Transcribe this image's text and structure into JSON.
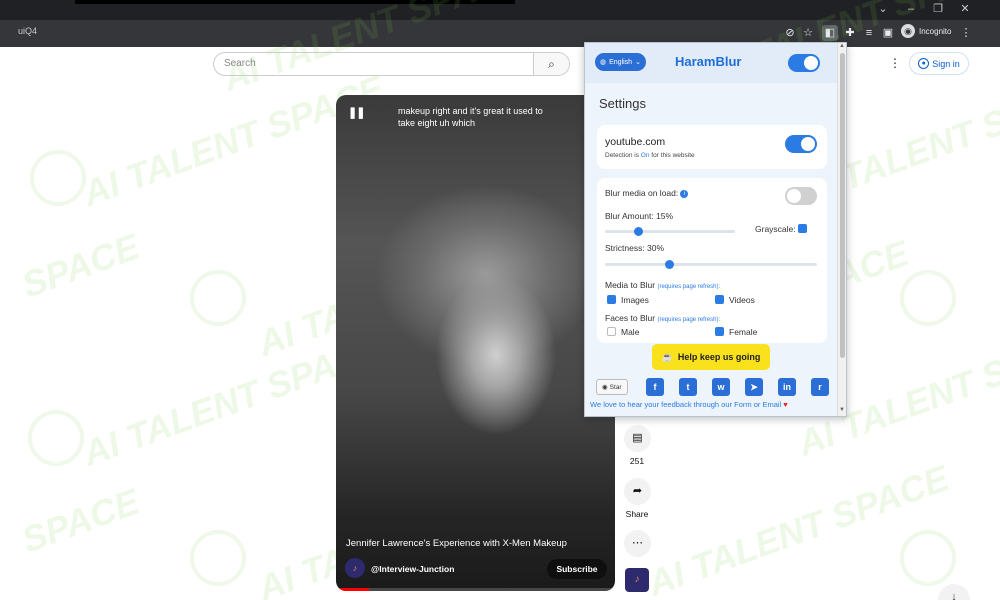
{
  "browser": {
    "url_fragment": "uiQ4",
    "profile_label": "Incognito",
    "window_controls": [
      "⌄",
      "–",
      "❐",
      "✕"
    ]
  },
  "youtube": {
    "search_placeholder": "Search",
    "sign_in_label": "Sign in",
    "video": {
      "caption": "makeup right and it's great it used to take eight uh which",
      "title": "Jennifer Lawrence's Experience with X-Men Makeup",
      "channel": "@Interview-Junction",
      "subscribe_label": "Subscribe",
      "progress": 0.12
    },
    "actions": {
      "comments_count": "251",
      "share_label": "Share"
    }
  },
  "watermark": {
    "text_full": "AI TALENT SPACE",
    "text_short": "SPACE"
  },
  "extension": {
    "language": "English",
    "brand": "HaramBlur",
    "enabled": true,
    "settings_title": "Settings",
    "site": {
      "domain": "youtube.com",
      "detection_prefix": "Detection is ",
      "detection_state": "On",
      "detection_suffix": " for this website",
      "enabled": true
    },
    "options": {
      "blur_on_load_label": "Blur media on load:",
      "blur_on_load": false,
      "blur_amount_label": "Blur Amount: 15%",
      "blur_amount": 15,
      "grayscale_label": "Grayscale:",
      "grayscale": true,
      "strictness_label": "Strictness: 30%",
      "strictness": 30,
      "media_label": "Media to Blur",
      "requires_refresh": "(requires page refresh):",
      "media_images": "Images",
      "media_images_checked": true,
      "media_videos": "Videos",
      "media_videos_checked": true,
      "faces_label": "Faces to Blur",
      "faces_male": "Male",
      "faces_male_checked": false,
      "faces_female": "Female",
      "faces_female_checked": true
    },
    "help_label": "Help keep us going",
    "star_label": "Star",
    "social_icons": [
      "facebook-icon",
      "twitter-icon",
      "whatsapp-icon",
      "telegram-icon",
      "linkedin-icon",
      "reddit-icon"
    ],
    "social_glyphs": [
      "f",
      "t",
      "w",
      "➤",
      "in",
      "r"
    ],
    "feedback_text": "We love to hear your feedback through our Form or Email",
    "accent_color": "#2b7be4",
    "help_color": "#f9e11b"
  }
}
